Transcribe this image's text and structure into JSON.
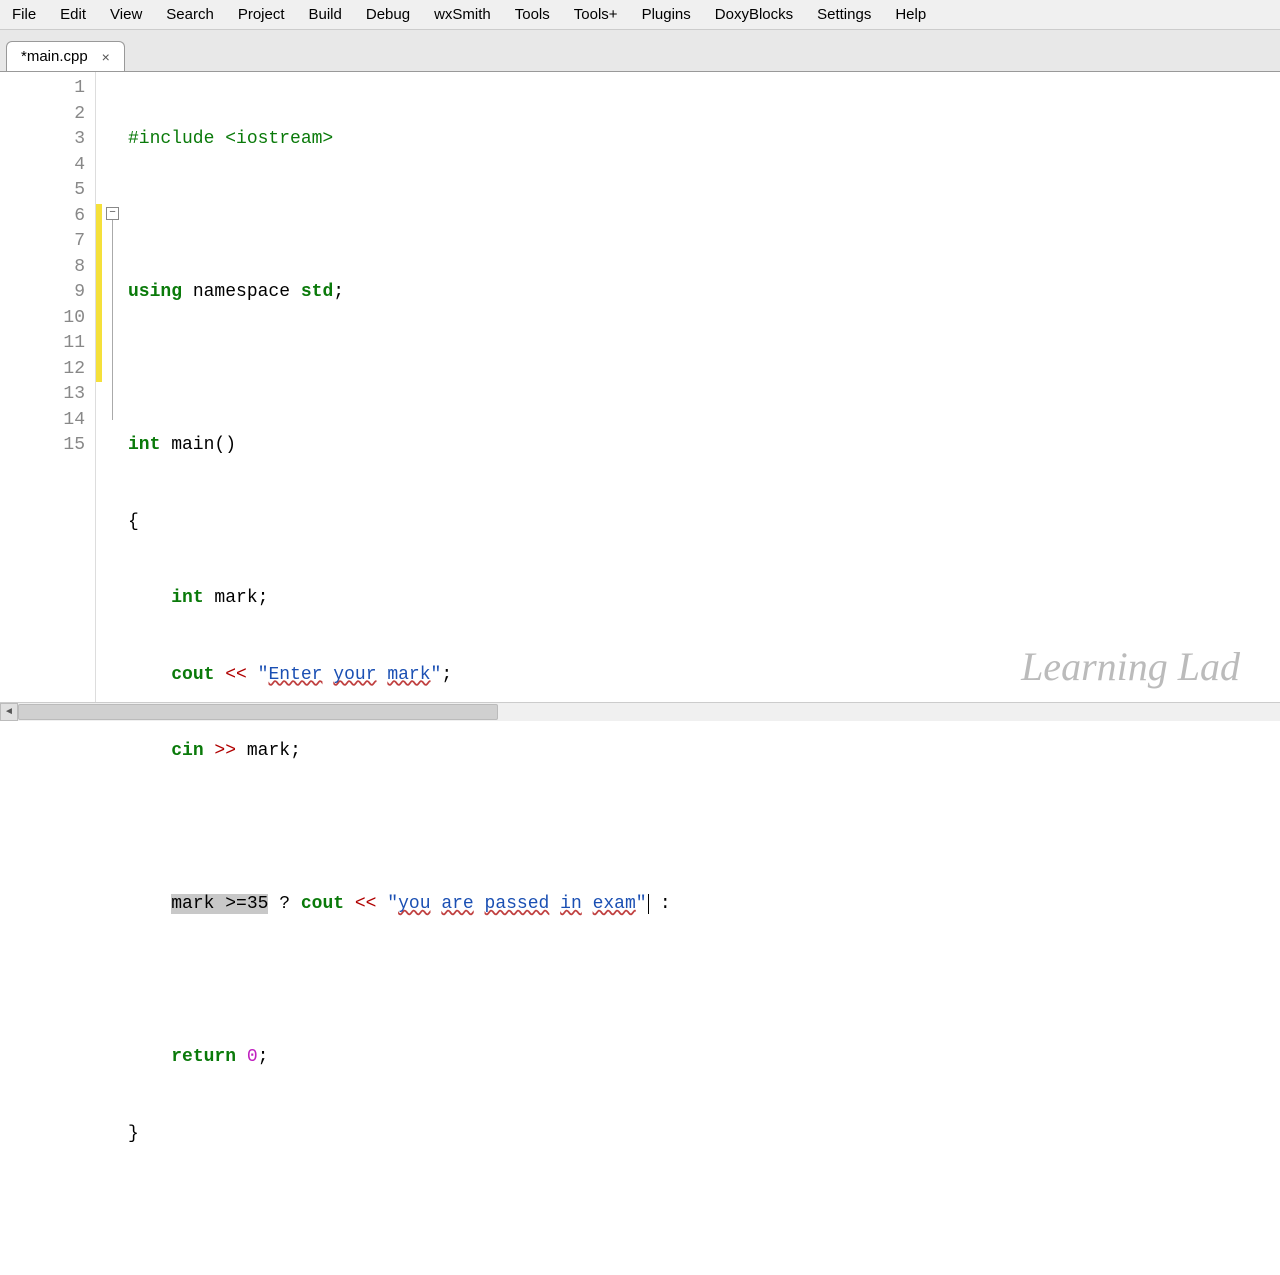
{
  "menu": {
    "items": [
      "File",
      "Edit",
      "View",
      "Search",
      "Project",
      "Build",
      "Debug",
      "wxSmith",
      "Tools",
      "Tools+",
      "Plugins",
      "DoxyBlocks",
      "Settings",
      "Help"
    ]
  },
  "tab": {
    "title": "*main.cpp",
    "close": "×"
  },
  "lines": [
    "1",
    "2",
    "3",
    "4",
    "5",
    "6",
    "7",
    "8",
    "9",
    "10",
    "11",
    "12",
    "13",
    "14",
    "15"
  ],
  "foldbox": "−",
  "code": {
    "l1_pre": "#include ",
    "l1_hdr": "<iostream>",
    "l3_using": "using",
    "l3_ns": " namespace ",
    "l3_std": "std",
    "l3_semi": ";",
    "l5_int": "int",
    "l5_main": " main",
    "l5_par": "()",
    "l6_brace": "{",
    "l7_int": "int",
    "l7_rest": " mark",
    "l7_semi": ";",
    "l8_cout": "cout",
    "l8_op": " << ",
    "l8_q1": "\"",
    "l8_s1": "Enter",
    "l8_sp1": " ",
    "l8_s2": "your",
    "l8_sp2": " ",
    "l8_s3": "mark",
    "l8_q2": "\"",
    "l8_semi": ";",
    "l9_cin": "cin",
    "l9_op": " >> ",
    "l9_mark": "mark",
    "l9_semi": ";",
    "l11_sel": "mark >=35",
    "l11_q": " ? ",
    "l11_cout": "cout",
    "l11_op": " << ",
    "l11_q1": "\"",
    "l11_s1": "you",
    "l11_sp1": " ",
    "l11_s2": "are",
    "l11_sp2": " ",
    "l11_s3": "passed",
    "l11_sp3": " ",
    "l11_s4": "in",
    "l11_sp4": " ",
    "l11_s5": "exam",
    "l11_q2": "\"",
    "l11_colon": " :",
    "l13_ret": "return",
    "l13_sp": " ",
    "l13_zero": "0",
    "l13_semi": ";",
    "l14_brace": "}"
  },
  "watermark": "Learning Lad",
  "scroll": {
    "left": "◄"
  }
}
